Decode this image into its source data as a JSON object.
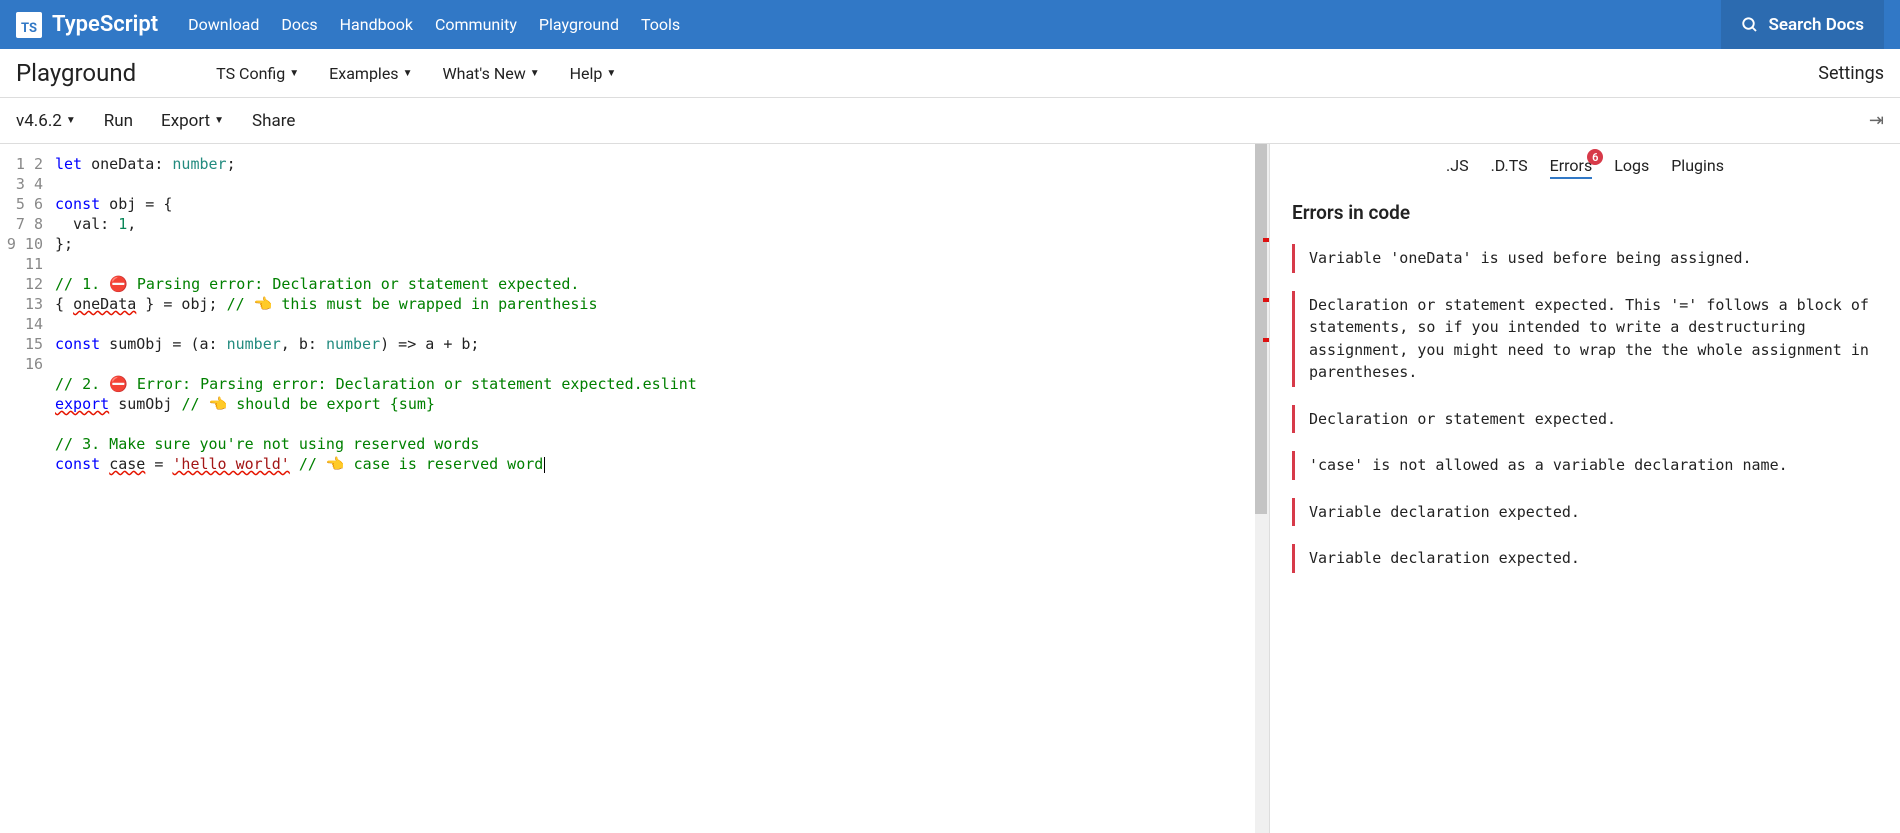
{
  "brand": {
    "abbr": "TS",
    "name": "TypeScript"
  },
  "nav": {
    "download": "Download",
    "docs": "Docs",
    "handbook": "Handbook",
    "community": "Community",
    "playground": "Playground",
    "tools": "Tools"
  },
  "search": {
    "label": "Search Docs"
  },
  "subnav": {
    "title": "Playground",
    "tsconfig": "TS Config",
    "examples": "Examples",
    "whatsnew": "What's New",
    "help": "Help",
    "settings": "Settings"
  },
  "toolbar": {
    "version": "v4.6.2",
    "run": "Run",
    "export": "Export",
    "share": "Share"
  },
  "editor": {
    "lineCount": 16,
    "lines": {
      "l1_let": "let",
      "l1_id": " oneData: ",
      "l1_type": "number",
      "l1_end": ";",
      "l3_kw": "const",
      "l3_rest": " obj = {",
      "l4": "  val: ",
      "l4_num": "1",
      "l4_end": ",",
      "l5": "};",
      "l7_a": "// 1. ",
      "l7_b": "⛔",
      "l7_c": " Parsing error: Declaration or statement expected.",
      "l8_a": "{ ",
      "l8_sq": "oneData",
      "l8_b": " } = obj; ",
      "l8_c": "// 👈 this must be wrapped in parenthesis",
      "l10_kw": "const",
      "l10_a": " sumObj = (a: ",
      "l10_t1": "number",
      "l10_b": ", b: ",
      "l10_t2": "number",
      "l10_c": ") => a + b;",
      "l12_a": "// 2. ",
      "l12_b": "⛔",
      "l12_c": " Error: Parsing error: Declaration or statement expected.eslint",
      "l13_sq": "export",
      "l13_a": " sumObj ",
      "l13_c": "// 👈 should be export {sum}",
      "l15": "// 3. Make sure you're not using reserved words",
      "l16_kw": "const",
      "l16_sp": " ",
      "l16_sq": "case",
      "l16_a": " = ",
      "l16_str": "'hello world'",
      "l16_b": " ",
      "l16_c": "// 👈 case is reserved word"
    }
  },
  "output": {
    "tabs": {
      "js": ".JS",
      "dts": ".D.TS",
      "errors": "Errors",
      "logs": "Logs",
      "plugins": "Plugins"
    },
    "errorBadge": "6",
    "title": "Errors in code",
    "errors": [
      "Variable 'oneData' is used before being assigned.",
      "Declaration or statement expected. This '=' follows a block of statements, so if you intended to write a destructuring assignment, you might need to wrap the the whole assignment in parentheses.",
      "Declaration or statement expected.",
      "'case' is not allowed as a variable declaration name.",
      "Variable declaration expected.",
      "Variable declaration expected."
    ]
  }
}
